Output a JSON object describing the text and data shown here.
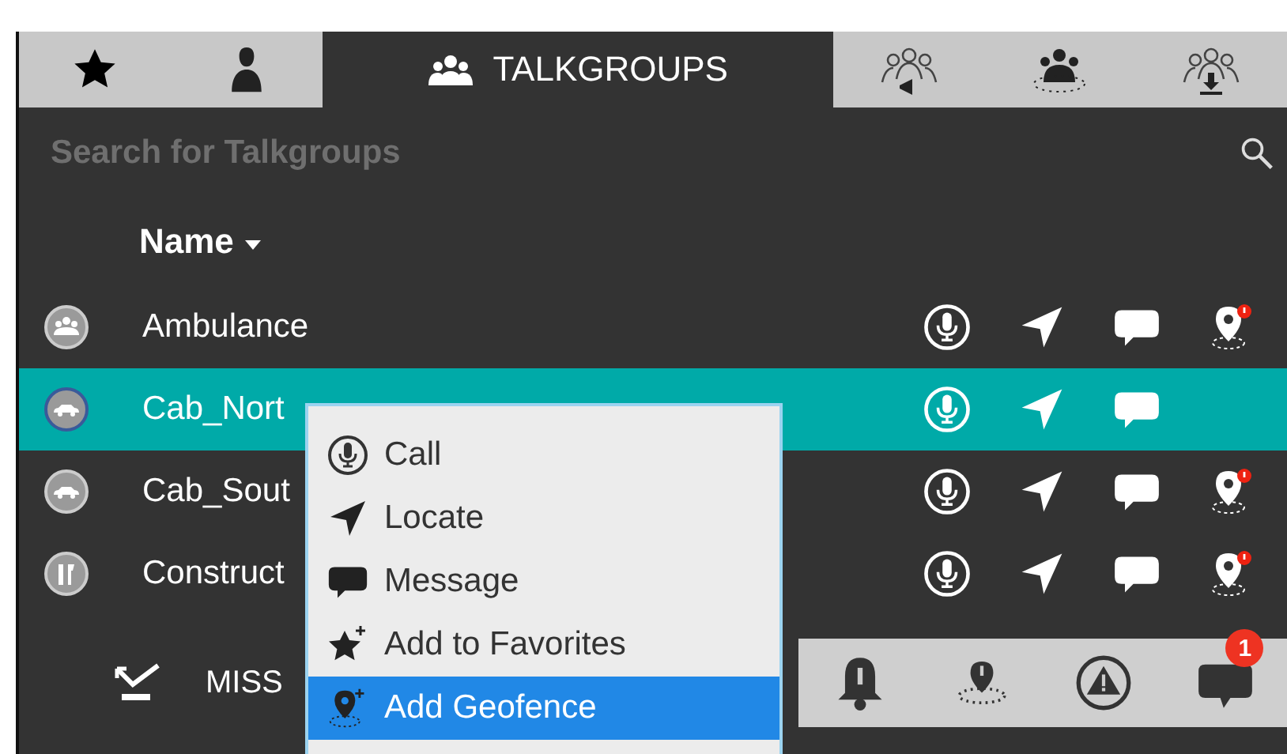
{
  "tabs": [
    {
      "kind": "favorites",
      "selected": false
    },
    {
      "kind": "contacts",
      "selected": false
    },
    {
      "kind": "talkgroups",
      "label": "TALKGROUPS",
      "selected": true
    },
    {
      "kind": "broadcast",
      "selected": false
    },
    {
      "kind": "dynamic",
      "selected": false
    },
    {
      "kind": "download",
      "selected": false
    }
  ],
  "search": {
    "placeholder": "Search for Talkgroups"
  },
  "list": {
    "column": "Name",
    "rows": [
      {
        "name": "Ambulance",
        "kind": "ambulance",
        "selected": false,
        "geofence": true
      },
      {
        "name": "Cab_Nort",
        "kind": "cab",
        "selected": true,
        "geofence": false
      },
      {
        "name": "Cab_Sout",
        "kind": "cab",
        "selected": false,
        "geofence": true
      },
      {
        "name": "Construct",
        "kind": "construction",
        "selected": false,
        "geofence": true
      }
    ]
  },
  "bottom_bar": {
    "label": "MISS",
    "tabs": [
      {
        "kind": "alerts"
      },
      {
        "kind": "geofence"
      },
      {
        "kind": "emergency"
      },
      {
        "kind": "messages",
        "badge": "1"
      }
    ]
  },
  "context_menu": [
    {
      "kind": "call",
      "label": "Call",
      "selected": false
    },
    {
      "kind": "locate",
      "label": "Locate",
      "selected": false
    },
    {
      "kind": "message",
      "label": "Message",
      "selected": false
    },
    {
      "kind": "favorite",
      "label": "Add to Favorites",
      "selected": false
    },
    {
      "kind": "geofence",
      "label": "Add Geofence",
      "selected": true
    }
  ]
}
